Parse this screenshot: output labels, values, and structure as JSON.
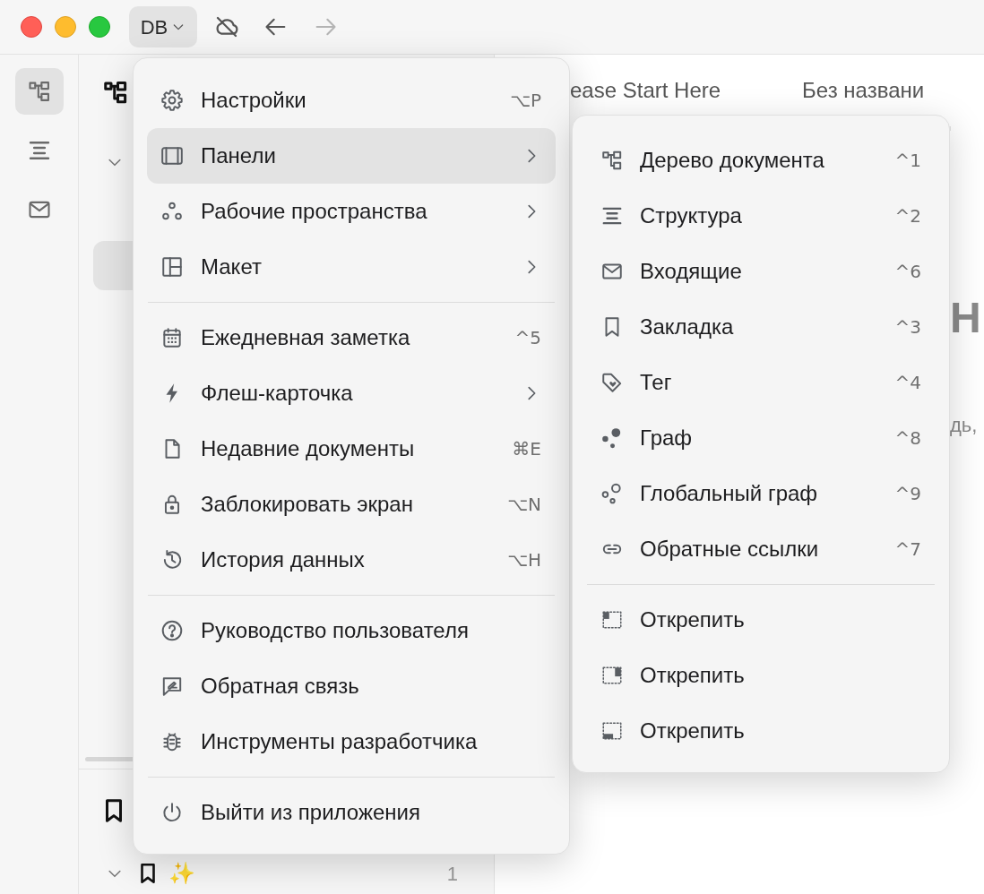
{
  "titlebar": {
    "workspace_button": {
      "label": "DB"
    },
    "nav_buttons": [
      {
        "kind": "back",
        "disabled": false
      },
      {
        "kind": "forward",
        "disabled": true
      }
    ]
  },
  "activity_bar": [
    {
      "kind": "tree",
      "selected": true
    },
    {
      "kind": "outline",
      "selected": false
    },
    {
      "kind": "inbox",
      "selected": false
    }
  ],
  "sidebar": {
    "tree": [
      {
        "expanded": true,
        "children": [
          {
            "selected": true
          }
        ]
      }
    ],
    "bookmarks": [
      {
        "expanded": true,
        "title": "✨",
        "count": "1"
      }
    ]
  },
  "tabs": [
    {
      "label": "ease Start Here",
      "selected": false
    },
    {
      "label": "Без названи",
      "selected": true
    }
  ],
  "editor": {
    "heading": "Н",
    "text": "дь,"
  },
  "menu": {
    "groups": [
      [
        {
          "kind": "gear",
          "label": "Настройки",
          "shortcut": "⌥P",
          "submenu": false,
          "selected": false
        },
        {
          "kind": "panels",
          "label": "Панели",
          "submenu": true,
          "selected": true
        },
        {
          "kind": "workspaces",
          "label": "Рабочие пространства",
          "submenu": true,
          "selected": false
        },
        {
          "kind": "layout",
          "label": "Макет",
          "submenu": true,
          "selected": false
        }
      ],
      [
        {
          "kind": "calendar",
          "label": "Ежедневная заметка",
          "shortcut": "^5",
          "submenu": false,
          "selected": false
        },
        {
          "kind": "bolt",
          "label": "Флеш-карточка",
          "submenu": true,
          "selected": false
        },
        {
          "kind": "file",
          "label": "Недавние документы",
          "shortcut": "⌘E",
          "submenu": false,
          "selected": false
        },
        {
          "kind": "lock",
          "label": "Заблокировать экран",
          "shortcut": "⌥N",
          "submenu": false,
          "selected": false
        },
        {
          "kind": "history",
          "label": "История данных",
          "shortcut": "⌥H",
          "submenu": false,
          "selected": false
        }
      ],
      [
        {
          "kind": "help",
          "label": "Руководство пользователя",
          "submenu": false,
          "selected": false
        },
        {
          "kind": "feedback",
          "label": "Обратная связь",
          "submenu": false,
          "selected": false
        },
        {
          "kind": "bug",
          "label": "Инструменты разработчика",
          "submenu": false,
          "selected": false
        }
      ],
      [
        {
          "kind": "power",
          "label": "Выйти из приложения",
          "submenu": false,
          "selected": false
        }
      ]
    ]
  },
  "submenu": {
    "groups": [
      [
        {
          "kind": "tree",
          "label": "Дерево документа",
          "shortcut": "^1",
          "selected": false
        },
        {
          "kind": "outline",
          "label": "Структура",
          "shortcut": "^2",
          "selected": false
        },
        {
          "kind": "inbox",
          "label": "Входящие",
          "shortcut": "^6",
          "selected": false
        },
        {
          "kind": "bookmark",
          "label": "Закладка",
          "shortcut": "^3",
          "selected": false
        },
        {
          "kind": "tag",
          "label": "Тег",
          "shortcut": "^4",
          "selected": false
        },
        {
          "kind": "graph",
          "label": "Граф",
          "shortcut": "^8",
          "selected": false
        },
        {
          "kind": "global-graph",
          "label": "Глобальный граф",
          "shortcut": "^9",
          "selected": false
        },
        {
          "kind": "link",
          "label": "Обратные ссылки",
          "shortcut": "^7",
          "selected": false
        }
      ],
      [
        {
          "kind": "dock-left",
          "label": "Открепить",
          "selected": false
        },
        {
          "kind": "dock-right",
          "label": "Открепить",
          "selected": false
        },
        {
          "kind": "dock-bottom",
          "label": "Открепить",
          "selected": false
        }
      ]
    ]
  }
}
